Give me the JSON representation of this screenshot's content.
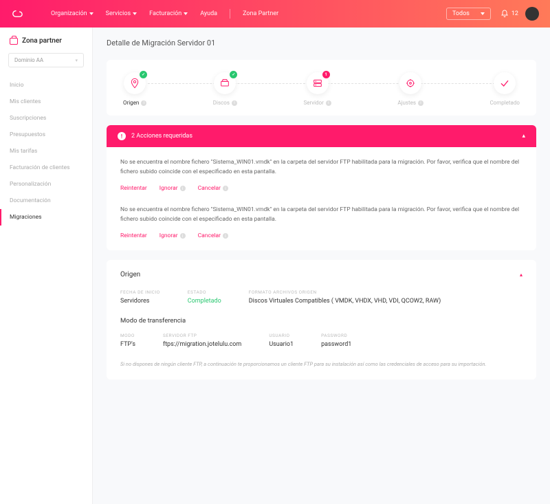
{
  "header": {
    "nav": {
      "org": "Organización",
      "services": "Servicios",
      "billing": "Facturación",
      "help": "Ayuda",
      "partner": "Zona Partner"
    },
    "filter_label": "Todos",
    "notif_count": "12"
  },
  "sidebar": {
    "title": "Zona partner",
    "domain_selected": "Dominio AA",
    "items": [
      {
        "label": "Inicio"
      },
      {
        "label": "Mis clientes"
      },
      {
        "label": "Suscripciones"
      },
      {
        "label": "Presupuestos"
      },
      {
        "label": "Mis tarifas"
      },
      {
        "label": "Facturación de clientes"
      },
      {
        "label": "Personalización"
      },
      {
        "label": "Documentación"
      },
      {
        "label": "Migraciones"
      }
    ]
  },
  "page": {
    "title": "Detalle de Migración Servidor 01"
  },
  "stepper": {
    "s1": "Origen",
    "s2": "Discos",
    "s3": "Servidor",
    "s4": "Ajustes",
    "s5": "Completado",
    "badge_err": "1"
  },
  "alert": {
    "title": "2 Acciones requeridas",
    "msg1": "No se encuentra el nombre fichero \"Sistema_WIN01.vmdk\" en la carpeta del servidor FTP habilitada para la migración. Por favor, verifica que el nombre del fichero subido  coincide con el especificado en esta pantalla.",
    "msg2": "No se encuentra el nombre fichero \"Sistema_WIN01.vmdk\" en la carpeta del servidor FTP habilitada para la migración. Por favor, verifica que el nombre del fichero subido  coincide con el especificado en esta pantalla.",
    "retry": "Reintentar",
    "ignore": "Ignorar",
    "cancel": "Cancelar"
  },
  "origin": {
    "title": "Origen",
    "start_label": "FECHA DE INICIO",
    "start_val": "Servidores",
    "state_label": "ESTADO",
    "state_val": "Completado",
    "format_label": "FORMATO ARCHIVOS ORIGEN",
    "format_val": "Discos Virtuales Compatibles ( VMDK, VHDX, VHD, VDI, QCOW2, RAW)",
    "transfer_title": "Modo de transferencia",
    "mode_label": "MODO",
    "mode_val": "FTP's",
    "server_label": "SERVIDOR FTP",
    "server_val": "ftps://migration.jotelulu.com",
    "user_label": "USUARIO",
    "user_val": "Usuario1",
    "pass_label": "PASSWORD",
    "pass_val": "password1",
    "footnote": "Si no  dispones de ningún cliente FTP,  a continuación te  proporcionamos un cliente FTP  para su instalación así como las credenciales de acceso para su importación."
  }
}
